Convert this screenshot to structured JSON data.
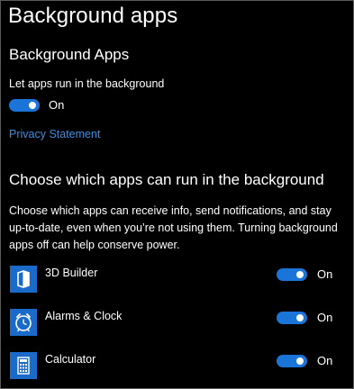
{
  "page": {
    "title": "Background apps"
  },
  "background_apps": {
    "heading": "Background Apps",
    "master_label": "Let apps run in the background",
    "master_state": "On",
    "privacy_link": "Privacy Statement"
  },
  "choose": {
    "heading": "Choose which apps can run in the background",
    "description": "Choose which apps can receive info, send notifications, and stay up-to-date, even when you’re not using them. Turning background apps off can help conserve power."
  },
  "apps": [
    {
      "name": "3D Builder",
      "state": "On",
      "icon": "3d-builder-icon"
    },
    {
      "name": "Alarms & Clock",
      "state": "On",
      "icon": "alarm-clock-icon"
    },
    {
      "name": "Calculator",
      "state": "On",
      "icon": "calculator-icon"
    }
  ],
  "colors": {
    "accent": "#1b74d8",
    "link": "#3a8fe0",
    "tile": "#1a6ac9",
    "background": "#000000"
  }
}
